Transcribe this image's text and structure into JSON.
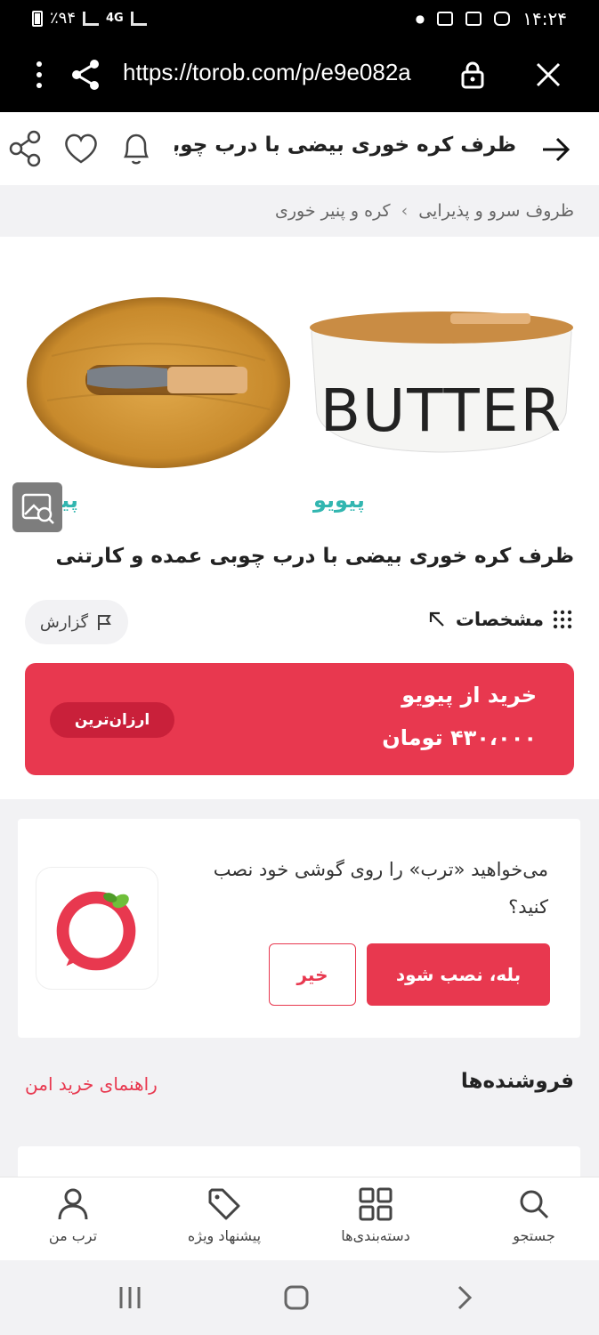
{
  "status_bar": {
    "battery": "٪۹۴",
    "network": "4G",
    "time": "۱۴:۲۴"
  },
  "browser": {
    "url": "https://torob.com/p/e9e082a"
  },
  "header": {
    "title": "ظرف کره خوری بیضی با درب چوبی..."
  },
  "breadcrumb": {
    "items": [
      "ظروف سرو و پذیرایی",
      "کره و پنیر خوری"
    ],
    "separator": "›"
  },
  "gallery": {
    "image_1_watermark": "پیویو",
    "image_2_watermark": "پیویو",
    "image_2_text": "BUTTER"
  },
  "product": {
    "title": "ظرف کره خوری بیضی با درب چوبی عمده و کارتنی",
    "specs_label": "مشخصات",
    "report_label": "گزارش"
  },
  "offer": {
    "shop": "خرید از پیویو",
    "price": "۴۳۰،۰۰۰ تومان",
    "badge": "ارزان‌ترین"
  },
  "install_prompt": {
    "question": "می‌خواهید «ترب» را روی گوشی خود نصب کنید؟",
    "yes_label": "بله، نصب شود",
    "no_label": "خیر"
  },
  "sellers": {
    "title": "فروشنده‌ها",
    "safe_guide": "راهنمای خرید امن"
  },
  "bottom_nav": {
    "items": [
      {
        "label": "جستجو",
        "icon": "search-icon"
      },
      {
        "label": "دسته‌بندی‌ها",
        "icon": "grid-icon"
      },
      {
        "label": "پیشنهاد ویژه",
        "icon": "tag-icon"
      },
      {
        "label": "ترب من",
        "icon": "user-icon"
      }
    ]
  },
  "colors": {
    "accent": "#e8384f",
    "background_gray": "#f2f2f4"
  }
}
